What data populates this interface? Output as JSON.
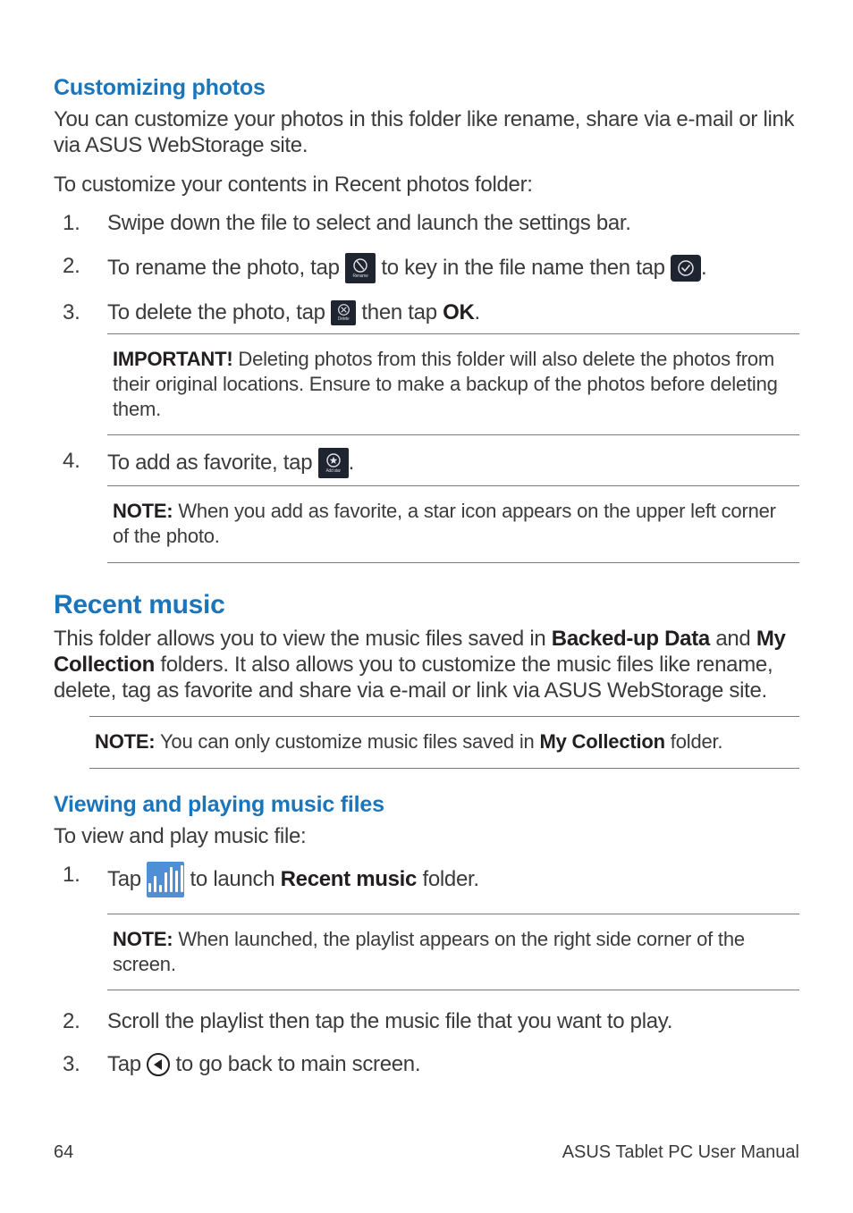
{
  "sections": {
    "customizing": {
      "heading": "Customizing photos",
      "intro": "You can customize your photos in this folder like rename, share via e-mail or link via ASUS WebStorage site.",
      "lead": "To customize your contents in Recent photos folder:",
      "steps": {
        "s1": "Swipe down the file to select and launch the settings bar.",
        "s2a": "To rename the photo, tap ",
        "s2b": " to key in the file name then tap ",
        "s2c": ".",
        "s3a": "To delete the photo, tap ",
        "s3b": " then tap ",
        "s3_ok": "OK",
        "s3c": ".",
        "s4a": "To add as favorite, tap ",
        "s4b": "."
      },
      "important_label": "IMPORTANT!",
      "important_text": "  Deleting photos from this folder will also delete the photos from their original locations. Ensure to make a backup of the photos before deleting them.",
      "note_label": "NOTE:",
      "note_text": "  When you add as favorite, a star icon appears on the upper left corner of the photo."
    },
    "recent_music": {
      "heading": "Recent music",
      "intro_a": "This folder allows you to view the music files saved in ",
      "intro_b1": "Backed-up Data",
      "intro_c": " and ",
      "intro_b2": "My Collection",
      "intro_d": " folders. It also allows you to customize the music files like rename, delete, tag as favorite and share via e-mail or link via ASUS WebStorage site.",
      "note_label": "NOTE:",
      "note_text_a": "  You can only customize music files saved in ",
      "note_bold": "My Collection",
      "note_text_b": " folder."
    },
    "viewing": {
      "heading": "Viewing and playing music files",
      "lead": "To view and play music file:",
      "steps": {
        "s1a": "Tap ",
        "s1b": " to launch ",
        "s1_bold": "Recent music",
        "s1c": " folder.",
        "s2": "Scroll the playlist then tap the music file that you want to play.",
        "s3a": "Tap ",
        "s3b": " to go back to main screen."
      },
      "note_label": "NOTE:",
      "note_text": "  When launched, the playlist appears on the right side corner of the screen."
    }
  },
  "icons": {
    "rename_label": "Rename",
    "delete_label": "Delete",
    "addstar_label": "Add star"
  },
  "footer": {
    "page": "64",
    "title": "ASUS Tablet PC User Manual"
  }
}
